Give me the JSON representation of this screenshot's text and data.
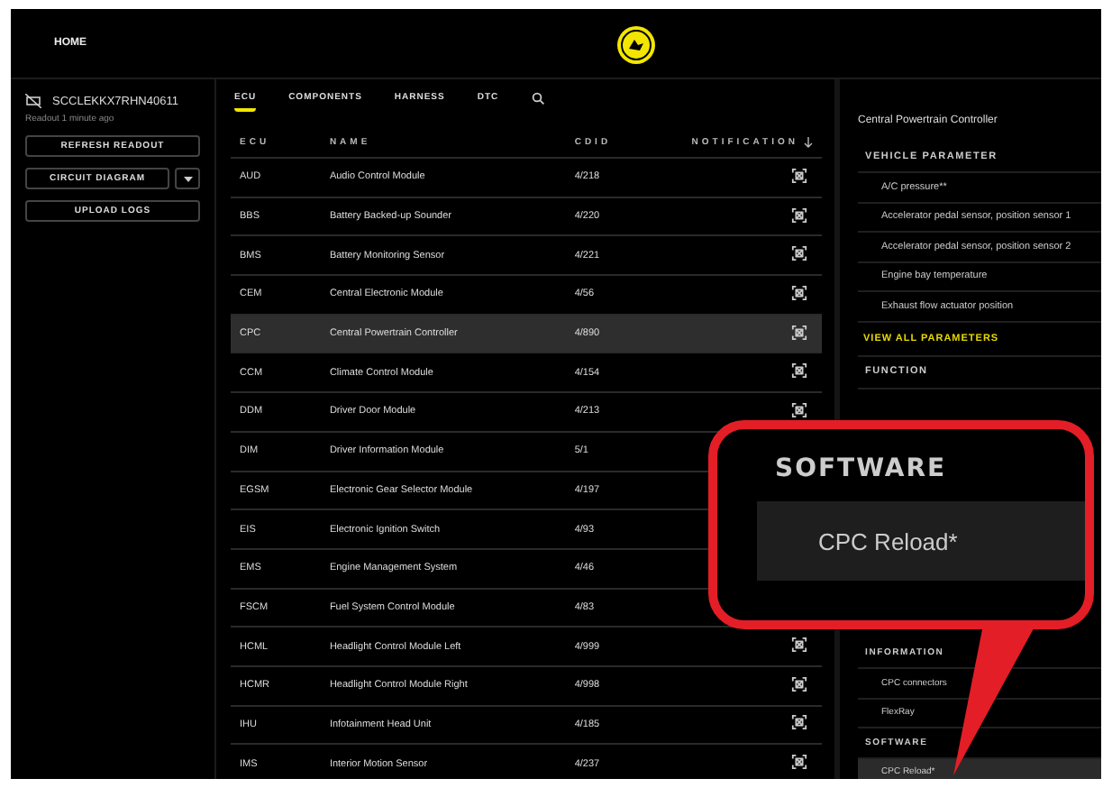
{
  "topbar": {
    "title": "HOME"
  },
  "vehicle": {
    "vin": "SCCLEKKX7RHN40611",
    "readout": "Readout 1 minute ago"
  },
  "actions": [
    {
      "label": "REFRESH READOUT",
      "kind": "button"
    },
    {
      "label": "CIRCUIT DIAGRAM",
      "kind": "dropdown"
    },
    {
      "label": "UPLOAD LOGS",
      "kind": "button"
    }
  ],
  "tabs": [
    {
      "label": "ECU",
      "selected": true
    },
    {
      "label": "COMPONENTS",
      "selected": false
    },
    {
      "label": "HARNESS",
      "selected": false
    },
    {
      "label": "DTC",
      "selected": false
    }
  ],
  "table": {
    "columns": [
      "ECU",
      "NAME",
      "CDID",
      "NOTIFICATION"
    ],
    "rows": [
      {
        "ecu": "AUD",
        "name": "Audio Control Module",
        "cdid": "4/218",
        "selected": false
      },
      {
        "ecu": "BBS",
        "name": "Battery Backed-up Sounder",
        "cdid": "4/220",
        "selected": false
      },
      {
        "ecu": "BMS",
        "name": "Battery Monitoring Sensor",
        "cdid": "4/221",
        "selected": false
      },
      {
        "ecu": "CEM",
        "name": "Central Electronic Module",
        "cdid": "4/56",
        "selected": false
      },
      {
        "ecu": "CPC",
        "name": "Central Powertrain Controller",
        "cdid": "4/890",
        "selected": true
      },
      {
        "ecu": "CCM",
        "name": "Climate Control Module",
        "cdid": "4/154",
        "selected": false
      },
      {
        "ecu": "DDM",
        "name": "Driver Door Module",
        "cdid": "4/213",
        "selected": false
      },
      {
        "ecu": "DIM",
        "name": "Driver Information Module",
        "cdid": "5/1",
        "selected": false
      },
      {
        "ecu": "EGSM",
        "name": "Electronic Gear Selector Module",
        "cdid": "4/197",
        "selected": false
      },
      {
        "ecu": "EIS",
        "name": "Electronic Ignition Switch",
        "cdid": "4/93",
        "selected": false
      },
      {
        "ecu": "EMS",
        "name": "Engine Management System",
        "cdid": "4/46",
        "selected": false
      },
      {
        "ecu": "FSCM",
        "name": "Fuel System Control Module",
        "cdid": "4/83",
        "selected": false
      },
      {
        "ecu": "HCML",
        "name": "Headlight Control Module Left",
        "cdid": "4/999",
        "selected": false
      },
      {
        "ecu": "HCMR",
        "name": "Headlight Control Module Right",
        "cdid": "4/998",
        "selected": false
      },
      {
        "ecu": "IHU",
        "name": "Infotainment Head Unit",
        "cdid": "4/185",
        "selected": false
      },
      {
        "ecu": "IMS",
        "name": "Interior Motion Sensor",
        "cdid": "4/237",
        "selected": false
      }
    ]
  },
  "panel": {
    "title": "Central Powertrain Controller",
    "upper": [
      {
        "kind": "heading",
        "label": "VEHICLE PARAMETER"
      },
      {
        "kind": "item",
        "label": "A/C pressure**",
        "selected": false
      },
      {
        "kind": "item",
        "label": "Accelerator pedal sensor, position sensor 1",
        "selected": false
      },
      {
        "kind": "item",
        "label": "Accelerator pedal sensor, position sensor 2",
        "selected": false
      },
      {
        "kind": "item",
        "label": "Engine bay temperature",
        "selected": false
      },
      {
        "kind": "item",
        "label": "Exhaust flow actuator position",
        "selected": false
      },
      {
        "kind": "link",
        "label": "VIEW ALL PARAMETERS"
      },
      {
        "kind": "heading",
        "label": "FUNCTION"
      }
    ],
    "lower": [
      {
        "kind": "heading",
        "label": "INFORMATION"
      },
      {
        "kind": "item",
        "label": "CPC connectors",
        "selected": false
      },
      {
        "kind": "item",
        "label": "FlexRay",
        "selected": false
      },
      {
        "kind": "heading",
        "label": "SOFTWARE"
      },
      {
        "kind": "item",
        "label": "CPC Reload*",
        "selected": true
      }
    ]
  },
  "callout": {
    "heading": "SOFTWARE",
    "item": "CPC Reload*"
  }
}
